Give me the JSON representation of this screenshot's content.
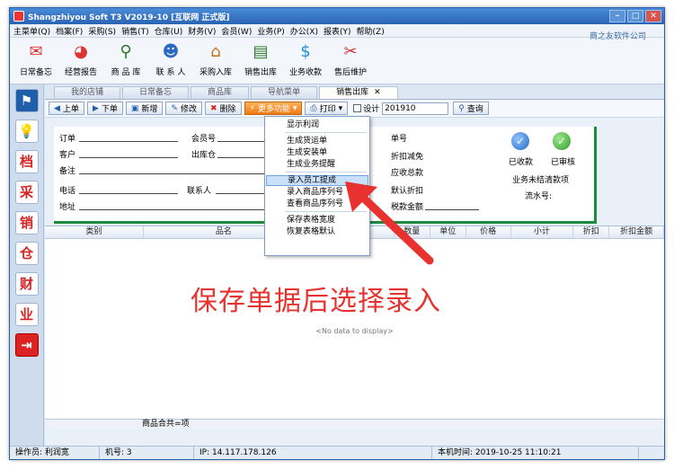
{
  "window": {
    "title": "Shangzhiyou Soft T3 V2019-10 [互联网 正式版]",
    "controls": [
      "–",
      "□",
      "✕"
    ]
  },
  "menu": [
    "主菜单(Q)",
    "档案(F)",
    "采购(S)",
    "销售(T)",
    "仓库(U)",
    "财务(V)",
    "会员(W)",
    "业务(P)",
    "办公(X)",
    "报表(Y)",
    "帮助(Z)"
  ],
  "toolbar": [
    {
      "label": "日常备忘",
      "icon": "mail-icon",
      "glyph": "✉",
      "color": "#d33"
    },
    {
      "label": "经营报告",
      "icon": "chart-icon",
      "glyph": "◕",
      "color": "#d33"
    },
    {
      "label": "商 品 库",
      "icon": "magnifier-icon",
      "glyph": "⚲",
      "color": "#2a7a2a"
    },
    {
      "label": "联 系 人",
      "icon": "contacts-icon",
      "glyph": "☻",
      "color": "#2a6ac4"
    },
    {
      "label": "采购入库",
      "icon": "house-icon",
      "glyph": "⌂",
      "color": "#c86b1a"
    },
    {
      "label": "销售出库",
      "icon": "document-icon",
      "glyph": "▤",
      "color": "#2a7a2a"
    },
    {
      "label": "业务收款",
      "icon": "dollar-icon",
      "glyph": "$",
      "color": "#1f8fd8"
    },
    {
      "label": "售后维护",
      "icon": "tools-icon",
      "glyph": "✂",
      "color": "#c33"
    }
  ],
  "company": "商之友软件公司",
  "leftnav": [
    {
      "glyph": "⚑",
      "icon": "flag-icon",
      "style": "blue"
    },
    {
      "glyph": "💡",
      "icon": "lightbulb-icon",
      "style": "plain"
    },
    {
      "glyph": "档",
      "icon": "archive-icon",
      "style": "plain"
    },
    {
      "glyph": "采",
      "icon": "purchase-icon",
      "style": "plain"
    },
    {
      "glyph": "销",
      "icon": "sales-icon",
      "style": "plain"
    },
    {
      "glyph": "仓",
      "icon": "warehouse-icon",
      "style": "plain"
    },
    {
      "glyph": "财",
      "icon": "finance-icon",
      "style": "plain"
    },
    {
      "glyph": "业",
      "icon": "business-icon",
      "style": "plain"
    },
    {
      "glyph": "⇥",
      "icon": "exit-icon",
      "style": "red"
    }
  ],
  "tabs": [
    "我的店铺",
    "日常备忘",
    "商品库",
    "导航菜单",
    "销售出库"
  ],
  "tab_close": "✕",
  "actions": {
    "up": "上单",
    "down": "下单",
    "new": "新增",
    "edit": "修改",
    "delete": "删除",
    "more": "更多功能",
    "print": "打印",
    "design": "设计",
    "date": "201910",
    "query": "查询"
  },
  "form": {
    "order": "订单",
    "member": "会员号",
    "customer": "客户",
    "warehouse": "出库仓",
    "note": "备注",
    "phone": "电话",
    "contact": "联系人",
    "address": "地址",
    "bill_no": "单号",
    "discount": "折扣减免",
    "receivable": "应收总款",
    "default_discount": "默认折扣",
    "tax_amount": "税款金额",
    "received": "已收款",
    "audited": "已审核",
    "pending": "业务未结清款项",
    "serial": "流水号:"
  },
  "grid": {
    "columns": [
      "类别",
      "品名",
      "",
      "数量",
      "单位",
      "价格",
      "小计",
      "折扣",
      "折扣金额"
    ],
    "empty": "<No data to display>",
    "footer": "商品合共=项"
  },
  "popup": {
    "items": [
      {
        "label": "显示利润",
        "sep_after": true
      },
      {
        "label": "生成货运单"
      },
      {
        "label": "生成安装单"
      },
      {
        "label": "生成业务提醒",
        "sep_after": true
      },
      {
        "label": "录入员工提成",
        "highlight": true
      },
      {
        "label": "录入商品序列号"
      },
      {
        "label": "查看商品序列号",
        "sep_after": true
      },
      {
        "label": "保存表格宽度"
      },
      {
        "label": "恢复表格默认"
      }
    ]
  },
  "status": {
    "operator": "操作员: 利润宽",
    "machine": "机号: 3",
    "ip": "IP: 14.117.178.126",
    "time": "本机时间: 2019-10-25 11:10:21"
  },
  "annotation": "保存单据后选择录入",
  "colors": {
    "annotation": "#e8322f",
    "accent": "#2a64b4",
    "form_border": "#1e8a3c"
  }
}
